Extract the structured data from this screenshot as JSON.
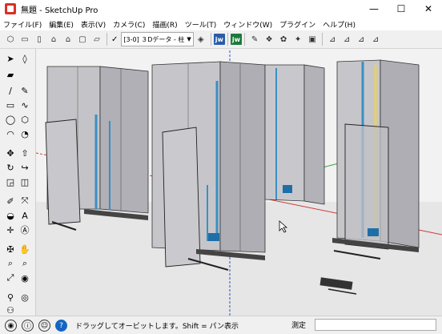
{
  "window": {
    "title": "無題 - SketchUp Pro",
    "controls": {
      "minimize": "—",
      "maximize": "☐",
      "close": "✕"
    }
  },
  "menu": [
    "ファイル(F)",
    "編集(E)",
    "表示(V)",
    "カメラ(C)",
    "描画(R)",
    "ツール(T)",
    "ウィンドウ(W)",
    "プラグイン",
    "ヘルプ(H)"
  ],
  "toolbar": {
    "layer_check": "✓",
    "layer_value": "[3-0] ３Dデータ - 柱",
    "jw_label": "jw",
    "jw2_label": "jw"
  },
  "status": {
    "hint": "ドラッグしてオービットします。Shift = パン表示",
    "measure_label": "測定",
    "measure_value": ""
  },
  "icons": {
    "app": "sketchup-logo",
    "status": [
      "geolocation-icon",
      "credits-icon",
      "user-icon",
      "help-icon"
    ]
  },
  "colors": {
    "pipe_blue": "#3a8fc4",
    "pipe_yellow": "#e8d060",
    "axis_red": "#d23a3a",
    "axis_green": "#3aa03a",
    "axis_blue": "#2f4fd0",
    "panel_gray": "#b4b4b8"
  }
}
